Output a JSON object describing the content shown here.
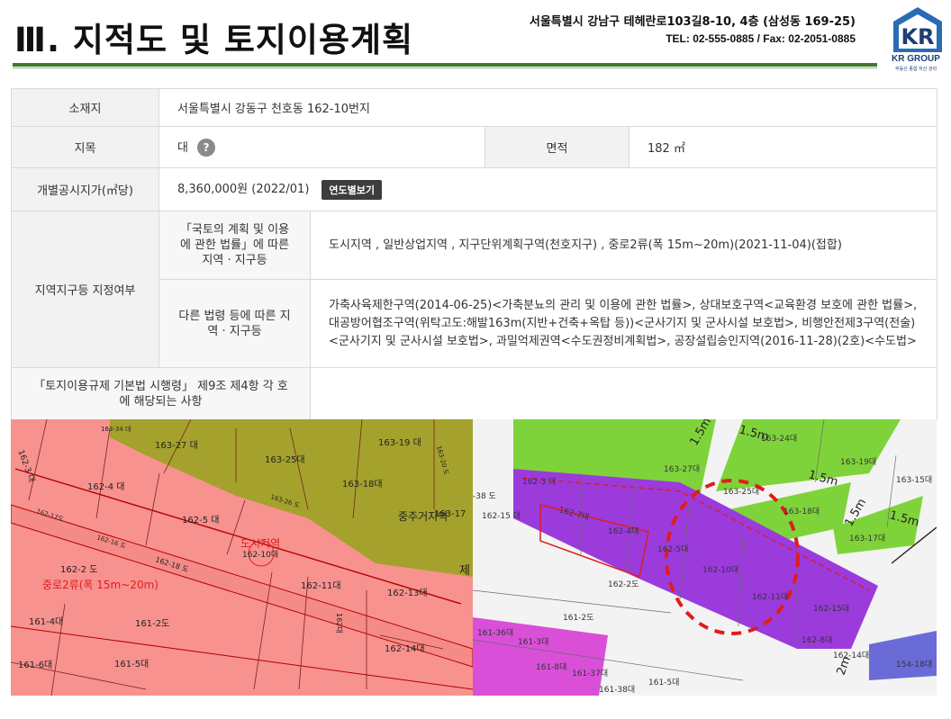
{
  "header": {
    "title": "Ⅲ. 지적도 및 토지이용계획",
    "address": "서울특별시 강남구 테헤란로103길8-10, 4층 (삼성동 169-25)",
    "contact": "TEL: 02-555-0885  / Fax: 02-2051-0885",
    "logo_brand": "KR GROUP",
    "logo_sub": "부동산 종합 자산 관리",
    "logo_letters": "KR"
  },
  "info_table": {
    "location_label": "소재지",
    "location_value": "서울특별시 강동구 천호동 162-10번지",
    "land_category_label": "지목",
    "land_category_value": "대",
    "help_icon": "question-icon",
    "help_glyph": "?",
    "area_label": "면적",
    "area_value": "182 ㎡",
    "price_label": "개별공시지가(㎡당)",
    "price_value": "8,360,000원 (2022/01)",
    "yearly_view_button": "연도별보기",
    "zoning_label": "지역지구등 지정여부",
    "national_law_label": "「국토의 계획 및 이용에 관한 법률」에 따른 지역 · 지구등",
    "national_law_value": "도시지역 , 일반상업지역 , 지구단위계획구역(천호지구) , 중로2류(폭 15m~20m)(2021-11-04)(접합)",
    "other_law_label": "다른 법령 등에 따른 지역 · 지구등",
    "other_law_value": "가축사육제한구역(2014-06-25)<가축분뇨의 관리 및 이용에 관한 법률>, 상대보호구역<교육환경 보호에 관한 법률>, 대공방어협조구역(위탁고도:해발163m(지반+건축+옥탑 등))<군사기지 및 군사시설 보호법>, 비행안전제3구역(전술)<군사기지 및 군사시설 보호법>, 과밀억제권역<수도권정비계획법>, 공장설립승인지역(2016-11-28)(2호)<수도법>",
    "decree_label": "「토지이용규제 기본법 시행령」 제9조 제4항 각 호에 해당되는 사항",
    "decree_value": ""
  },
  "cadastral_map": {
    "parcels": [
      "163-34 대",
      "163-27 대",
      "163-25대",
      "163-19 대",
      "163-18대",
      "163-17",
      "162-3 대",
      "162-4 대",
      "162-5 대",
      "162-10대",
      "162-2 도",
      "162-11대",
      "162-13대",
      "162-14대",
      "162-16 도",
      "162-18 도",
      "162-17도",
      "163-26 도",
      "163-20 도",
      "161-4대",
      "161-2도",
      "161-6대",
      "161-5대",
      "162대",
      "제"
    ],
    "zone_label": "도시지역",
    "road_label": "중로2류(폭 15m~20m)",
    "commerce_label": "중주거지역"
  },
  "zoning_map": {
    "parcels": [
      "162-3 대",
      "162-7대",
      "162-4대",
      "162-5대",
      "162-10대",
      "162-11대",
      "162-15대",
      "162-8대",
      "163-27대",
      "163-25대",
      "163-24대",
      "163-19대",
      "163-18대",
      "163-17대",
      "163-15대",
      "162-2도",
      "161-2도",
      "162-15 대",
      "161-36대",
      "161-3대",
      "161-8대",
      "161-37대",
      "161-38대",
      "161-5대",
      "162-14대",
      "154-18대",
      "-38 도"
    ],
    "widths": [
      "1.5m",
      "1.5m",
      "1.5m",
      "1.5m",
      "1.5m",
      "2m"
    ],
    "colors": {
      "commercial": "#9b3bdc",
      "green_zone": "#7fd33a",
      "pink_zone": "#d94fd8",
      "highlight": "#e01d1d"
    }
  }
}
